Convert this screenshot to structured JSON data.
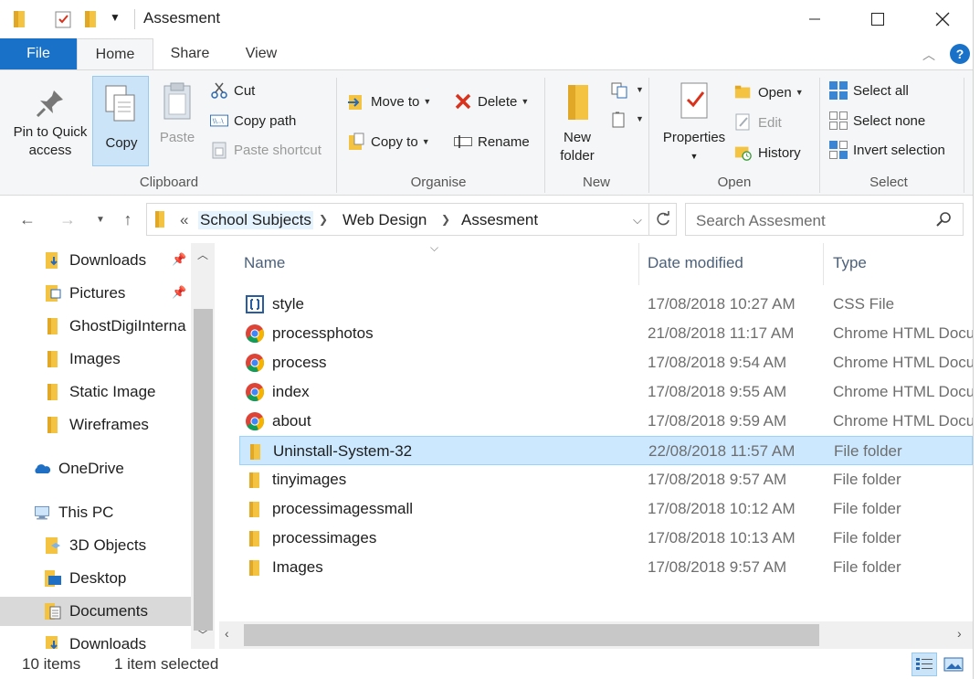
{
  "window": {
    "title": "Assesment"
  },
  "ribbon": {
    "tabs": [
      {
        "label": "File"
      },
      {
        "label": "Home"
      },
      {
        "label": "Share"
      },
      {
        "label": "View"
      }
    ],
    "clipboard": {
      "pin_label_1": "Pin to Quick",
      "pin_label_2": "access",
      "copy": "Copy",
      "paste": "Paste",
      "cut": "Cut",
      "copy_path": "Copy path",
      "paste_shortcut": "Paste shortcut",
      "group": "Clipboard"
    },
    "organise": {
      "move_to": "Move to",
      "copy_to": "Copy to",
      "delete": "Delete",
      "rename": "Rename",
      "group": "Organise"
    },
    "new": {
      "new_folder_1": "New",
      "new_folder_2": "folder",
      "group": "New"
    },
    "open": {
      "properties": "Properties",
      "open": "Open",
      "edit": "Edit",
      "history": "History",
      "group": "Open"
    },
    "select": {
      "select_all": "Select all",
      "select_none": "Select none",
      "invert_selection": "Invert selection",
      "group": "Select"
    }
  },
  "address": {
    "overflow": "«",
    "crumbs": [
      "School Subjects",
      "Web Design",
      "Assesment"
    ],
    "search_placeholder": "Search Assesment"
  },
  "nav_pane": {
    "items": [
      {
        "label": "Downloads",
        "pinned": true,
        "icon": "downloads-folder-icon"
      },
      {
        "label": "Pictures",
        "pinned": true,
        "icon": "pictures-folder-icon"
      },
      {
        "label": "GhostDigiInterna",
        "pinned": false,
        "icon": "folder-icon"
      },
      {
        "label": "Images",
        "pinned": false,
        "icon": "folder-icon"
      },
      {
        "label": "Static Image",
        "pinned": false,
        "icon": "folder-icon"
      },
      {
        "label": "Wireframes",
        "pinned": false,
        "icon": "folder-icon"
      },
      {
        "label": "OneDrive",
        "icon": "onedrive-icon"
      },
      {
        "label": "This PC",
        "icon": "this-pc-icon"
      },
      {
        "label": "3D Objects",
        "icon": "3d-objects-icon"
      },
      {
        "label": "Desktop",
        "icon": "desktop-icon"
      },
      {
        "label": "Documents",
        "icon": "documents-icon",
        "selected": true
      },
      {
        "label": "Downloads",
        "icon": "downloads-folder-icon"
      }
    ]
  },
  "file_list": {
    "columns": [
      "Name",
      "Date modified",
      "Type"
    ],
    "rows": [
      {
        "name": "style",
        "date": "17/08/2018 10:27 AM",
        "type": "CSS File",
        "icon": "css-file-icon"
      },
      {
        "name": "processphotos",
        "date": "21/08/2018 11:17 AM",
        "type": "Chrome HTML Docu",
        "icon": "chrome-html-icon"
      },
      {
        "name": "process",
        "date": "17/08/2018 9:54 AM",
        "type": "Chrome HTML Docu",
        "icon": "chrome-html-icon"
      },
      {
        "name": "index",
        "date": "17/08/2018 9:55 AM",
        "type": "Chrome HTML Docu",
        "icon": "chrome-html-icon"
      },
      {
        "name": "about",
        "date": "17/08/2018 9:59 AM",
        "type": "Chrome HTML Docu",
        "icon": "chrome-html-icon"
      },
      {
        "name": "Uninstall-System-32",
        "date": "22/08/2018 11:57 AM",
        "type": "File folder",
        "icon": "folder-icon",
        "selected": true
      },
      {
        "name": "tinyimages",
        "date": "17/08/2018 9:57 AM",
        "type": "File folder",
        "icon": "folder-icon"
      },
      {
        "name": "processimagessmall",
        "date": "17/08/2018 10:12 AM",
        "type": "File folder",
        "icon": "folder-icon"
      },
      {
        "name": "processimages",
        "date": "17/08/2018 10:13 AM",
        "type": "File folder",
        "icon": "folder-icon"
      },
      {
        "name": "Images",
        "date": "17/08/2018 9:57 AM",
        "type": "File folder",
        "icon": "folder-icon"
      }
    ]
  },
  "status": {
    "item_count": "10 items",
    "selection": "1 item selected"
  },
  "colors": {
    "accent": "#1a72c8",
    "folder": "#f5c342",
    "selection": "#cce8ff"
  }
}
